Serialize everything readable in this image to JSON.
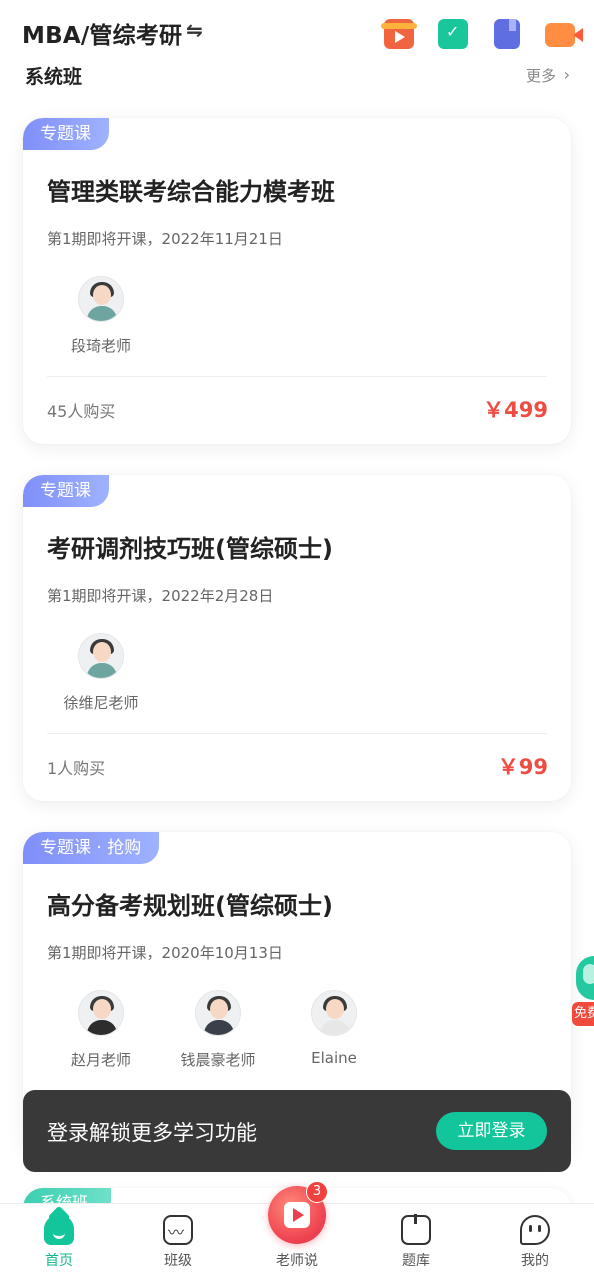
{
  "header": {
    "title": "MBA/管综考研",
    "switch_symbol": "⇋",
    "icons": [
      "video-gift-icon",
      "checkin-icon",
      "notebook-icon",
      "live-camera-icon"
    ]
  },
  "section": {
    "title": "系统班",
    "more_label": "更多",
    "more_symbol": "›"
  },
  "courses": [
    {
      "tag": "专题课",
      "title": "管理类联考综合能力模考班",
      "date": "第1期即将开课，2022年11月21日",
      "teachers": [
        "段琦老师"
      ],
      "buyers": "45人购买",
      "price": "￥499"
    },
    {
      "tag": "专题课",
      "title": "考研调剂技巧班(管综硕士)",
      "date": "第1期即将开课，2022年2月28日",
      "teachers": [
        "徐维尼老师"
      ],
      "buyers": "1人购买",
      "price": "￥99"
    },
    {
      "tag": "专题课 · 抢购",
      "title": "高分备考规划班(管综硕士)",
      "date": "第1期即将开课，2020年10月13日",
      "teachers": [
        "赵月老师",
        "钱晨豪老师",
        "Elaine"
      ]
    }
  ],
  "next_section_tag": "系统班",
  "login_banner": {
    "text": "登录解锁更多学习功能",
    "button": "立即登录"
  },
  "float_promo": {
    "label": "免费"
  },
  "bottom_nav": {
    "items": [
      {
        "label": "首页",
        "active": true
      },
      {
        "label": "班级",
        "active": false
      },
      {
        "label": "老师说",
        "active": false
      },
      {
        "label": "题库",
        "active": false
      },
      {
        "label": "我的",
        "active": false
      }
    ],
    "badge": "3"
  },
  "colors": {
    "accent": "#12c59a",
    "price": "#ee4d44",
    "tag_gradient_start": "#7f8ff9",
    "banner_bg": "#282828"
  }
}
